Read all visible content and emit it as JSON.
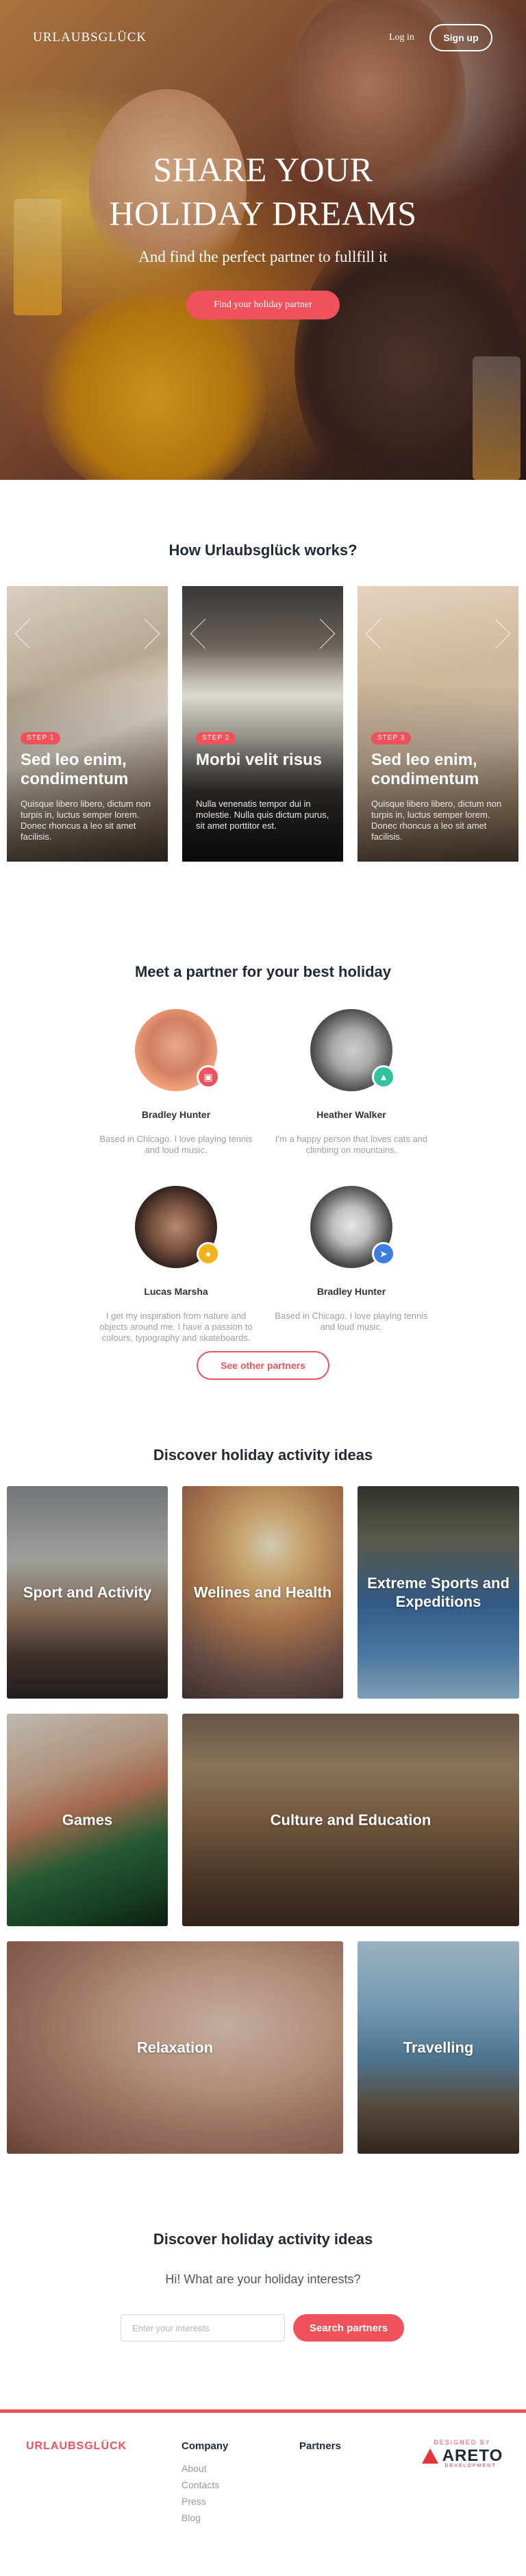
{
  "header": {
    "logo": "URLAUBSGLÜCK",
    "login": "Log in",
    "signup": "Sign up"
  },
  "hero": {
    "title_line1": "SHARE YOUR",
    "title_line2": "HOLIDAY DREAMS",
    "subtitle": "And find the perfect partner to fullfill it",
    "cta": "Find your holiday partner"
  },
  "how": {
    "title": "How Urlaubsglück works?",
    "steps": [
      {
        "badge": "STEP 1",
        "title": "Sed leo enim, condimentum",
        "text": "Quisque libero libero, dictum non turpis in, luctus semper lorem. Donec rhoncus a leo sit amet facilisis."
      },
      {
        "badge": "STEP 2",
        "title": "Morbi velit risus",
        "text": "Nulla venenatis tempor dui in molestie. Nulla quis dictum purus, sit amet porttitor est."
      },
      {
        "badge": "STEP 3",
        "title": "Sed leo enim, condimentum",
        "text": "Quisque libero libero, dictum non turpis in, luctus semper lorem. Donec rhoncus a leo sit amet facilisis."
      }
    ]
  },
  "partners": {
    "title": "Meet a partner for your best holiday",
    "items": [
      {
        "name": "Bradley Hunter",
        "text": "Based in Chicago. I love playing tennis and loud music.",
        "badge_icon": "suitcase-icon",
        "badge_color": "#f0515a"
      },
      {
        "name": "Heather Walker",
        "text": "I'm a happy person that loves cats and climbing on mountains.",
        "badge_icon": "mountain-icon",
        "badge_color": "#2ec4a0"
      },
      {
        "name": "Lucas Marsha",
        "text": "I get my inspiration from nature and objects around me. I have a passion to colours, typography and skateboards.",
        "badge_icon": "lock-icon",
        "badge_color": "#f2b41c"
      },
      {
        "name": "Bradley Hunter",
        "text": "Based in Chicago. I love playing tennis and loud music.",
        "badge_icon": "plane-icon",
        "badge_color": "#3b7de0"
      }
    ],
    "see_other": "See other partners"
  },
  "activities": {
    "title": "Discover holiday activity ideas",
    "tiles": [
      {
        "label": "Sport and Activity"
      },
      {
        "label": "Welines and Health"
      },
      {
        "label": "Extreme Sports and Expeditions"
      },
      {
        "label": "Games"
      },
      {
        "label": "Culture and Education"
      },
      {
        "label": "Relaxation"
      },
      {
        "label": "Travelling"
      }
    ]
  },
  "search": {
    "title": "Discover holiday activity ideas",
    "subtitle": "Hi! What are your holiday interests?",
    "placeholder": "Enter your interests",
    "button": "Search partners"
  },
  "footer": {
    "logo": "URLAUBSGLÜCK",
    "company": {
      "heading": "Company",
      "links": [
        "About",
        "Contacts",
        "Press",
        "Blog"
      ]
    },
    "partners": {
      "heading": "Partners"
    },
    "designed_by": "DESIGNED BY",
    "studio": "ARETO",
    "studio_sub": "DEVELOPMENT"
  },
  "colors": {
    "accent": "#f0515a",
    "heading": "#1e2a36",
    "muted": "#9aa0a6"
  }
}
